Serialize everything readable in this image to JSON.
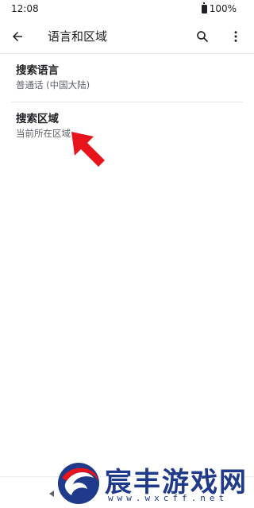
{
  "status_bar": {
    "time": "12:08",
    "battery": "100%"
  },
  "app_bar": {
    "title": "语言和区域",
    "back_icon": "arrow-back-icon",
    "search_icon": "search-icon",
    "more_icon": "more-vert-icon"
  },
  "preferences": [
    {
      "title": "搜索语言",
      "summary": "普通话 (中国大陆)"
    },
    {
      "title": "搜索区域",
      "summary": "当前所在区域"
    }
  ],
  "annotation": {
    "icon": "red-arrow-pointer",
    "color": "#e8141b"
  },
  "watermark": {
    "name": "宸丰游戏网",
    "url": "www.wxcff.net",
    "color": "#1f3a8a"
  }
}
